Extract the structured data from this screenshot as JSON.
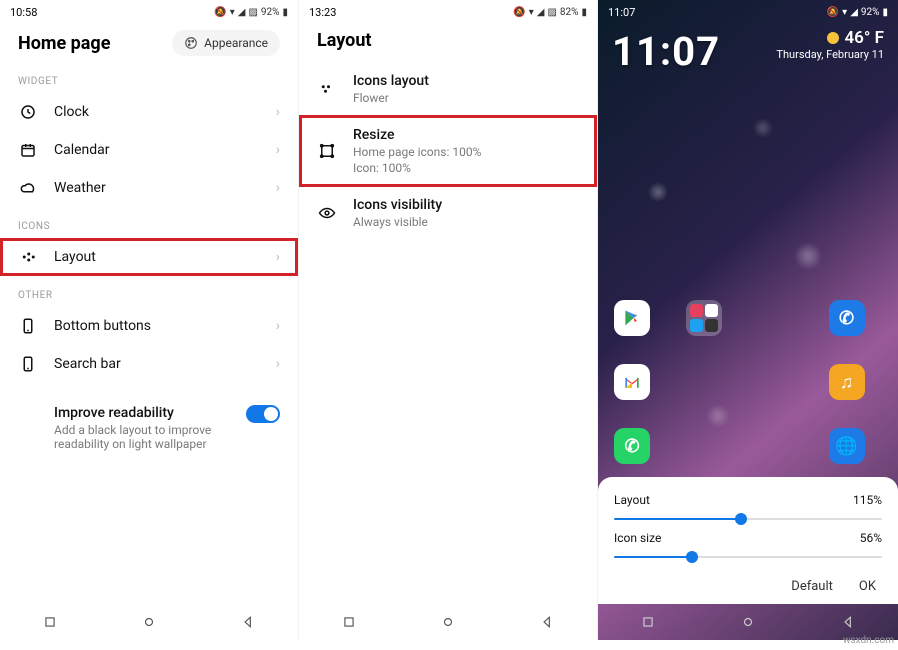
{
  "panel1": {
    "time": "10:58",
    "battery": "92%",
    "title": "Home page",
    "appearance": "Appearance",
    "sections": {
      "widget": "WIDGET",
      "icons": "ICONS",
      "other": "OTHER"
    },
    "items": {
      "clock": "Clock",
      "calendar": "Calendar",
      "weather": "Weather",
      "layout": "Layout",
      "bottom_buttons": "Bottom buttons",
      "search_bar": "Search bar"
    },
    "readability": {
      "title": "Improve readability",
      "sub": "Add a black layout to improve readability on light wallpaper"
    }
  },
  "panel2": {
    "time": "13:23",
    "battery": "82%",
    "title": "Layout",
    "items": {
      "icons_layout": {
        "label": "Icons layout",
        "sub": "Flower"
      },
      "resize": {
        "label": "Resize",
        "sub1": "Home page icons: 100%",
        "sub2": "Icon: 100%"
      },
      "visibility": {
        "label": "Icons visibility",
        "sub": "Always visible"
      }
    }
  },
  "panel3": {
    "time": "11:07",
    "battery": "92%",
    "clock": "11:07",
    "temp": "46° F",
    "date": "Thursday, February 11",
    "sheet": {
      "layout_label": "Layout",
      "layout_value": "115%",
      "icon_label": "Icon size",
      "icon_value": "56%",
      "default": "Default",
      "ok": "OK"
    }
  },
  "watermark": "wsxdn.com"
}
